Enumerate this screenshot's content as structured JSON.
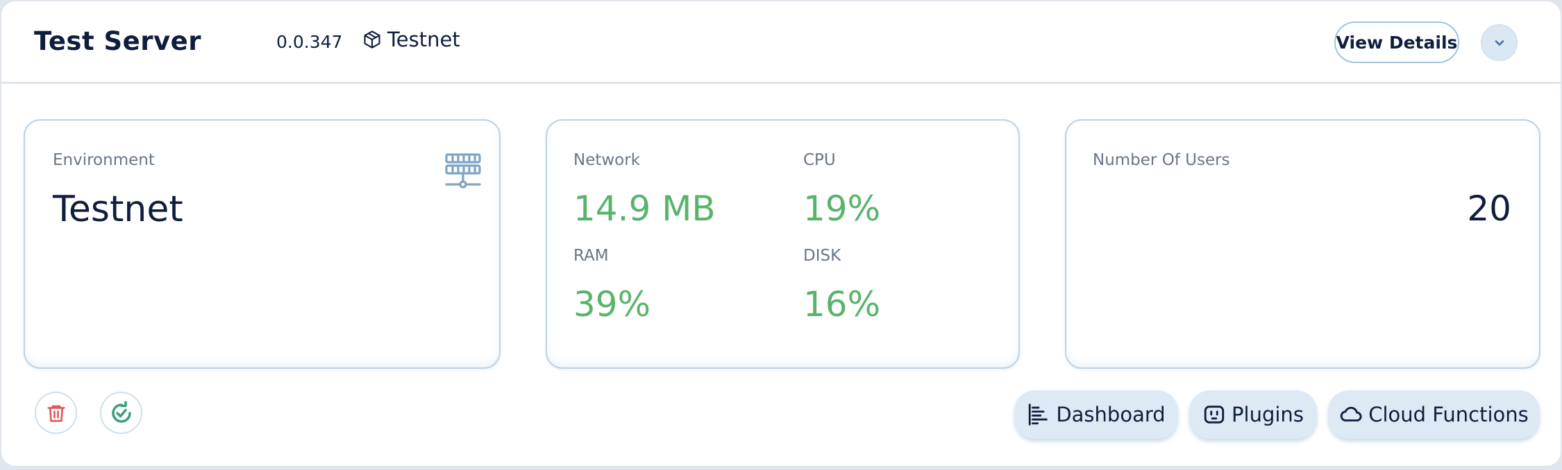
{
  "header": {
    "title": "Test Server",
    "version": "0.0.347",
    "environment_tag": "Testnet",
    "view_details_label": "View Details"
  },
  "environment_panel": {
    "label": "Environment",
    "value": "Testnet"
  },
  "stats_panel": {
    "network_label": "Network",
    "network_value": "14.9 MB",
    "cpu_label": "CPU",
    "cpu_value": "19%",
    "ram_label": "RAM",
    "ram_value": "39%",
    "disk_label": "DISK",
    "disk_value": "16%"
  },
  "users_panel": {
    "label": "Number Of Users",
    "value": "20"
  },
  "actions": {
    "dashboard_label": "Dashboard",
    "plugins_label": "Plugins",
    "cloud_functions_label": "Cloud Functions"
  },
  "colors": {
    "accent_green": "#59b46a",
    "danger_red": "#e05252",
    "text_dark": "#0f1e3d",
    "icon_blue": "#7ea3c4"
  },
  "icons": [
    "cube-icon",
    "chevron-down-icon",
    "server-icon",
    "trash-icon",
    "refresh-check-icon",
    "dashboard-icon",
    "plugin-icon",
    "cloud-icon"
  ]
}
